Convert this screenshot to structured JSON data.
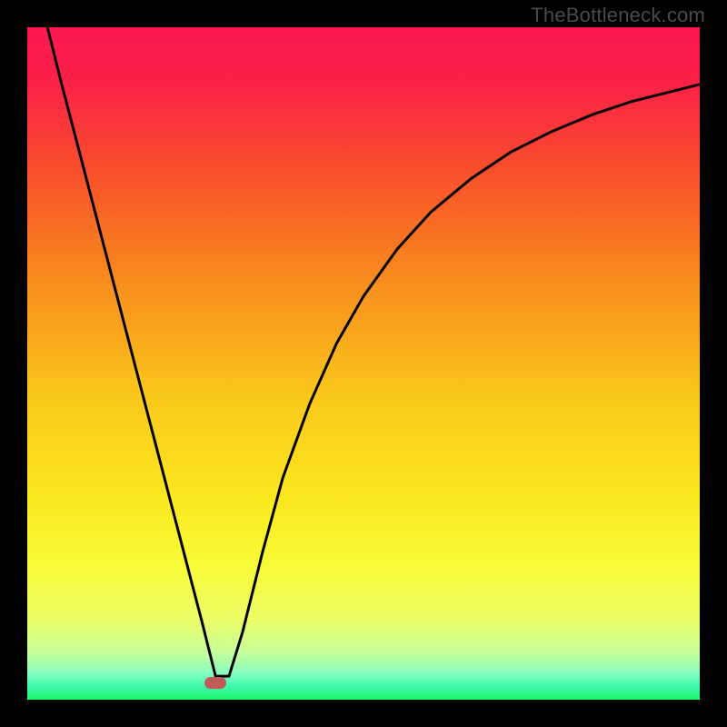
{
  "watermark": "TheBottleneck.com",
  "chart_data": {
    "type": "line",
    "title": "",
    "xlabel": "",
    "ylabel": "",
    "xlim": [
      0,
      100
    ],
    "ylim": [
      0,
      100
    ],
    "curve": {
      "x": [
        3,
        5,
        8,
        11,
        14,
        17,
        20,
        23,
        26,
        28,
        30,
        32,
        35,
        38,
        42,
        46,
        50,
        55,
        60,
        66,
        72,
        78,
        84,
        90,
        96,
        100
      ],
      "y": [
        100,
        92,
        80.5,
        69,
        57.5,
        46,
        34.5,
        23,
        11.5,
        3.5,
        3.5,
        10,
        22,
        33,
        44,
        53,
        60,
        67,
        72.5,
        77.5,
        81.5,
        84.5,
        87,
        89,
        90.5,
        91.5
      ]
    },
    "minimum_marker": {
      "x": 28,
      "y": 2.5,
      "width_pct": 3.2,
      "height_pct": 1.8
    },
    "gradient_stops": [
      {
        "offset": 0,
        "color": "#fb1851"
      },
      {
        "offset": 8,
        "color": "#fb2047"
      },
      {
        "offset": 20,
        "color": "#f94a2e"
      },
      {
        "offset": 35,
        "color": "#f8821e"
      },
      {
        "offset": 55,
        "color": "#fac81b"
      },
      {
        "offset": 70,
        "color": "#fbe81e"
      },
      {
        "offset": 80,
        "color": "#f8fb37"
      },
      {
        "offset": 88,
        "color": "#ecfd66"
      },
      {
        "offset": 93,
        "color": "#c6fe9b"
      },
      {
        "offset": 96,
        "color": "#87fdc0"
      },
      {
        "offset": 98,
        "color": "#3ff8af"
      },
      {
        "offset": 100,
        "color": "#1df567"
      }
    ]
  }
}
